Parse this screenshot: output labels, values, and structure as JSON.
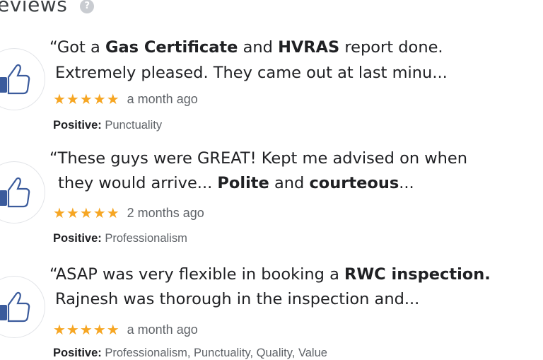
{
  "header": {
    "title": "eviews",
    "help_icon": "?"
  },
  "reviews": [
    {
      "line1": [
        "“Got a ",
        "Gas Certificate",
        " and ",
        "HVRAS",
        " report done."
      ],
      "line2": "Extremely pleased. They came out at last minu...",
      "stars": "★★★★★",
      "time": "a month ago",
      "attr_label": "Positive:",
      "attr_value": "Punctuality"
    },
    {
      "line1": "“These guys were GREAT! Kept me advised on when",
      "line2": [
        "they would arrive... ",
        "Polite",
        " and ",
        "courteous",
        "..."
      ],
      "stars": "★★★★★",
      "time": "2 months ago",
      "attr_label": "Positive:",
      "attr_value": "Professionalism"
    },
    {
      "line1": [
        "“ASAP was very flexible in booking a ",
        "RWC inspection."
      ],
      "line2": "Rajnesh was thorough in the inspection and...",
      "stars": "★★★★★",
      "time": "a month ago",
      "attr_label": "Positive:",
      "attr_value": "Professionalism, Punctuality, Quality, Value"
    }
  ]
}
